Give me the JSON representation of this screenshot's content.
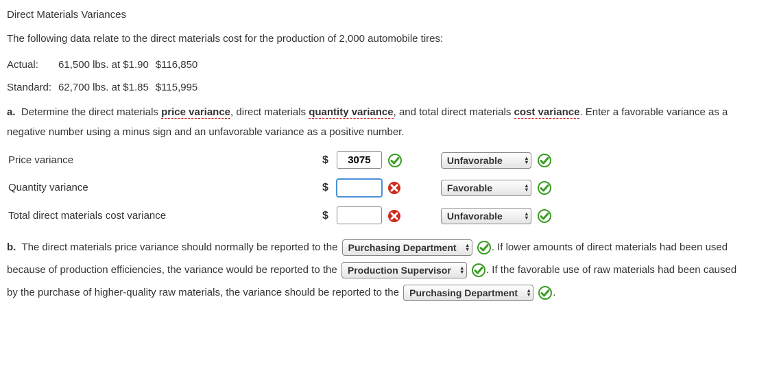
{
  "title": "Direct Materials Variances",
  "intro": "The following data relate to the direct materials cost for the production of 2,000 automobile tires:",
  "data_rows": {
    "actual": {
      "label": "Actual:",
      "qty": "61,500 lbs. at $1.90",
      "amt": "$116,850"
    },
    "standard": {
      "label": "Standard:",
      "qty": "62,700 lbs. at $1.85",
      "amt": "$115,995"
    }
  },
  "part_a": {
    "lead": "a.",
    "text1": "Determine the direct materials ",
    "term1": "price variance",
    "text2": ", direct materials ",
    "term2": "quantity variance",
    "text3": ", and total direct materials ",
    "term3": "cost variance",
    "text4": ". Enter a favorable variance as a negative number using a minus sign and an unfavorable variance as a positive number."
  },
  "rows": {
    "price": {
      "label": "Price variance",
      "value": "3075",
      "status": "correct",
      "fav": "Unfavorable",
      "fav_status": "correct"
    },
    "quantity": {
      "label": "Quantity variance",
      "value": "",
      "status": "incorrect",
      "fav": "Favorable",
      "fav_status": "correct"
    },
    "total": {
      "label": "Total direct materials cost variance",
      "value": "",
      "status": "incorrect",
      "fav": "Unfavorable",
      "fav_status": "correct"
    }
  },
  "part_b": {
    "lead": "b.",
    "seg1": "The direct materials price variance should normally be reported to the",
    "sel1": "Purchasing Department",
    "seg2": ". If lower amounts of direct materials had been used because of production efficiencies, the variance would be reported to the",
    "sel2": "Production Supervisor",
    "seg3": ". If the favorable use of raw materials had been caused by the purchase of higher-quality raw materials, the variance should be reported to the",
    "sel3": "Purchasing Department",
    "seg4": "."
  }
}
